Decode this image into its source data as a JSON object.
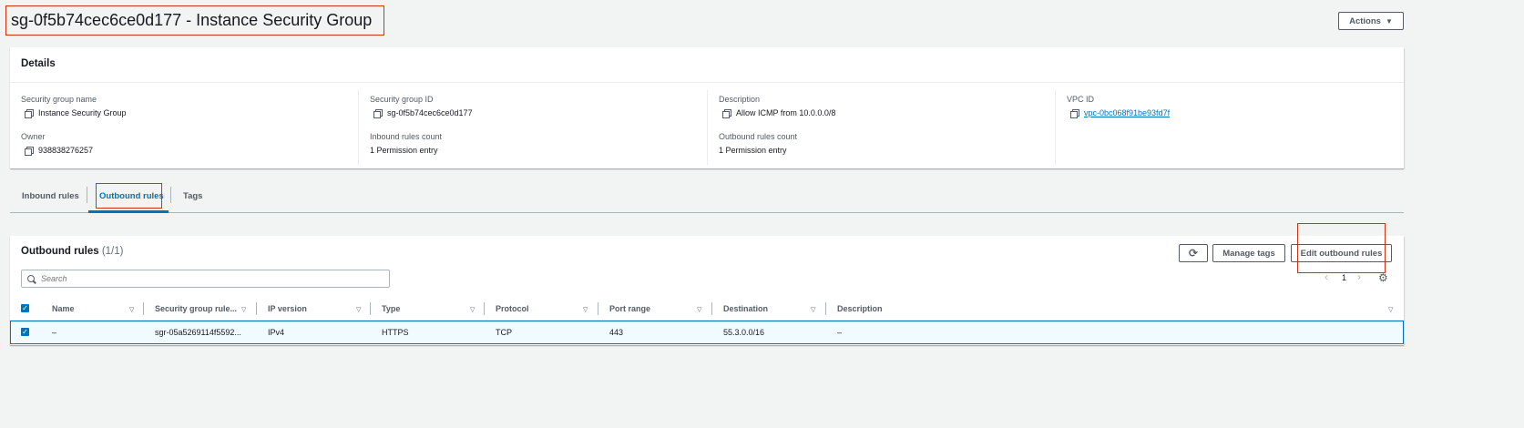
{
  "header": {
    "title": "sg-0f5b74cec6ce0d177 - Instance Security Group",
    "actions_label": "Actions",
    "actions_icon": "caret-down-icon"
  },
  "details": {
    "title": "Details",
    "sg_name_label": "Security group name",
    "sg_name_value": "Instance Security Group",
    "sg_id_label": "Security group ID",
    "sg_id_value": "sg-0f5b74cec6ce0d177",
    "description_label": "Description",
    "description_value": "Allow ICMP from 10.0.0.0/8",
    "vpc_label": "VPC ID",
    "vpc_value": "vpc-0bc068f91be93fd7f",
    "owner_label": "Owner",
    "owner_value": "938838276257",
    "inbound_count_label": "Inbound rules count",
    "inbound_count_value": "1 Permission entry",
    "outbound_count_label": "Outbound rules count",
    "outbound_count_value": "1 Permission entry"
  },
  "tabs": {
    "inbound": "Inbound rules",
    "outbound": "Outbound rules",
    "tags": "Tags"
  },
  "outbound": {
    "title": "Outbound rules",
    "count": "(1/1)",
    "manage_tags": "Manage tags",
    "edit_rules": "Edit outbound rules",
    "search_placeholder": "Search",
    "page": "1",
    "columns": [
      "Name",
      "Security group rule...",
      "IP version",
      "Type",
      "Protocol",
      "Port range",
      "Destination",
      "Description"
    ],
    "row": {
      "name": "–",
      "rule_id": "sgr-05a5269114f5592...",
      "ip_version": "IPv4",
      "type": "HTTPS",
      "protocol": "TCP",
      "port_range": "443",
      "destination": "55.3.0.0/16",
      "description": "–"
    }
  },
  "colors": {
    "accent": "#0073bb",
    "highlight": "#d13212"
  }
}
